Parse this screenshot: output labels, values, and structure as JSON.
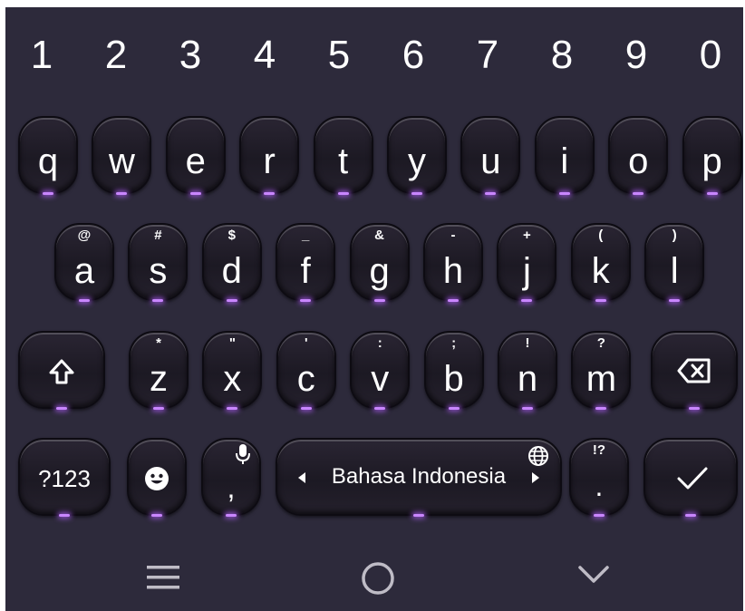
{
  "number_row": [
    "1",
    "2",
    "3",
    "4",
    "5",
    "6",
    "7",
    "8",
    "9",
    "0"
  ],
  "row1": [
    "q",
    "w",
    "e",
    "r",
    "t",
    "y",
    "u",
    "i",
    "o",
    "p"
  ],
  "row2": [
    {
      "label": "a",
      "hint": "@"
    },
    {
      "label": "s",
      "hint": "#"
    },
    {
      "label": "d",
      "hint": "$"
    },
    {
      "label": "f",
      "hint": "_"
    },
    {
      "label": "g",
      "hint": "&"
    },
    {
      "label": "h",
      "hint": "-"
    },
    {
      "label": "j",
      "hint": "+"
    },
    {
      "label": "k",
      "hint": "("
    },
    {
      "label": "l",
      "hint": ")"
    }
  ],
  "row3": [
    {
      "label": "z",
      "hint": "*"
    },
    {
      "label": "x",
      "hint": "\""
    },
    {
      "label": "c",
      "hint": "'"
    },
    {
      "label": "v",
      "hint": ":"
    },
    {
      "label": "b",
      "hint": ";"
    },
    {
      "label": "n",
      "hint": "!"
    },
    {
      "label": "m",
      "hint": "?"
    }
  ],
  "bottom": {
    "symbols_label": "?123",
    "comma_label": ",",
    "space_label": "Bahasa Indonesia",
    "period_label": ".",
    "period_hint": "!?"
  },
  "icons": {
    "shift": "shift-icon",
    "backspace": "backspace-icon",
    "emoji": "emoji-icon",
    "mic": "mic-icon",
    "globe": "globe-icon",
    "enter": "checkmark-icon",
    "nav_menu": "menu-icon",
    "nav_home": "home-circle-icon",
    "nav_hide": "chevron-down-icon"
  },
  "colors": {
    "background": "#2d2a3b",
    "glow": "#c986ff",
    "text": "#ffffff"
  }
}
